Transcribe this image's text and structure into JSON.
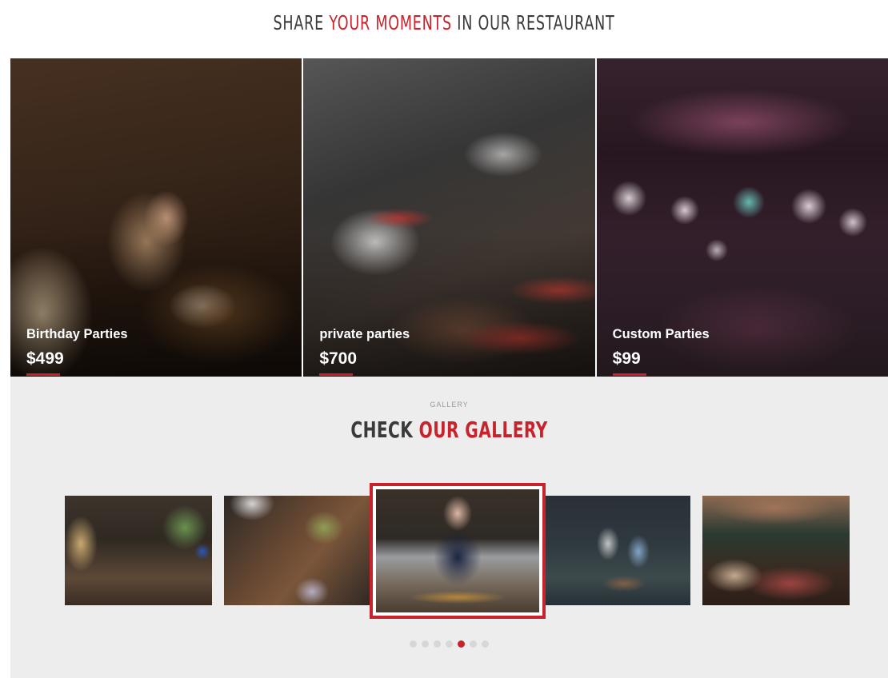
{
  "header": {
    "share_prefix": "SHARE ",
    "share_accent": "YOUR MOMENTS",
    "share_suffix": " IN OUR RESTAURANT"
  },
  "parties": [
    {
      "title": "Birthday Parties",
      "price": "$499"
    },
    {
      "title": "private parties",
      "price": "$700"
    },
    {
      "title": "Custom Parties",
      "price": "$99"
    }
  ],
  "gallery": {
    "eyebrow": "GALLERY",
    "heading_prefix": "CHECK ",
    "heading_accent": "OUR GALLERY",
    "dots_total": 7,
    "active_dot_index": 4
  },
  "colors": {
    "accent": "#c8232c",
    "text": "#3a3a3a",
    "section_bg": "#ededed"
  }
}
